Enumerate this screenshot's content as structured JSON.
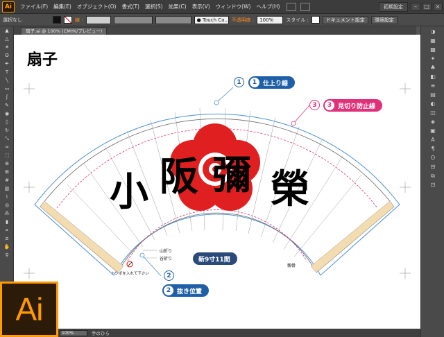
{
  "app": {
    "logo": "Ai"
  },
  "menu": [
    "ファイル(F)",
    "編集(E)",
    "オブジェクト(O)",
    "書式(T)",
    "選択(S)",
    "効果(C)",
    "表示(V)",
    "ウィンドウ(W)",
    "ヘルプ(H)"
  ],
  "workspace": "初期設定",
  "control": {
    "selection": "選択なし",
    "stroke_label": "線 :",
    "brush": "Touch Ca...",
    "opacity_label": "不透明度 :",
    "opacity_value": "100%",
    "style_label": "スタイル :",
    "doc_setup": "ドキュメント設定",
    "prefs": "環境設定"
  },
  "document": {
    "tab": "扇子.ai @ 100% (CMYK/プレビュー)",
    "title": "扇子",
    "calligraphy": [
      "小",
      "阪",
      "彌",
      "榮"
    ],
    "labels": {
      "mountain_fold": "山折り",
      "valley_fold": "谷折り",
      "size": "新9寸11間",
      "tombo": "トンボを入れて下さい",
      "oyabone": "親骨"
    },
    "callouts": [
      {
        "num": "1",
        "text": "仕上り線"
      },
      {
        "num": "2",
        "text": "抜き位置"
      },
      {
        "num": "3",
        "text": "見切り防止線"
      }
    ]
  },
  "status": {
    "zoom": "100%",
    "tool": "手のひら"
  },
  "colors": {
    "accent_blue": "#1e5fa8",
    "accent_pink": "#e0307a",
    "mon_red": "#e02020",
    "ai_orange": "#ff9a00"
  }
}
